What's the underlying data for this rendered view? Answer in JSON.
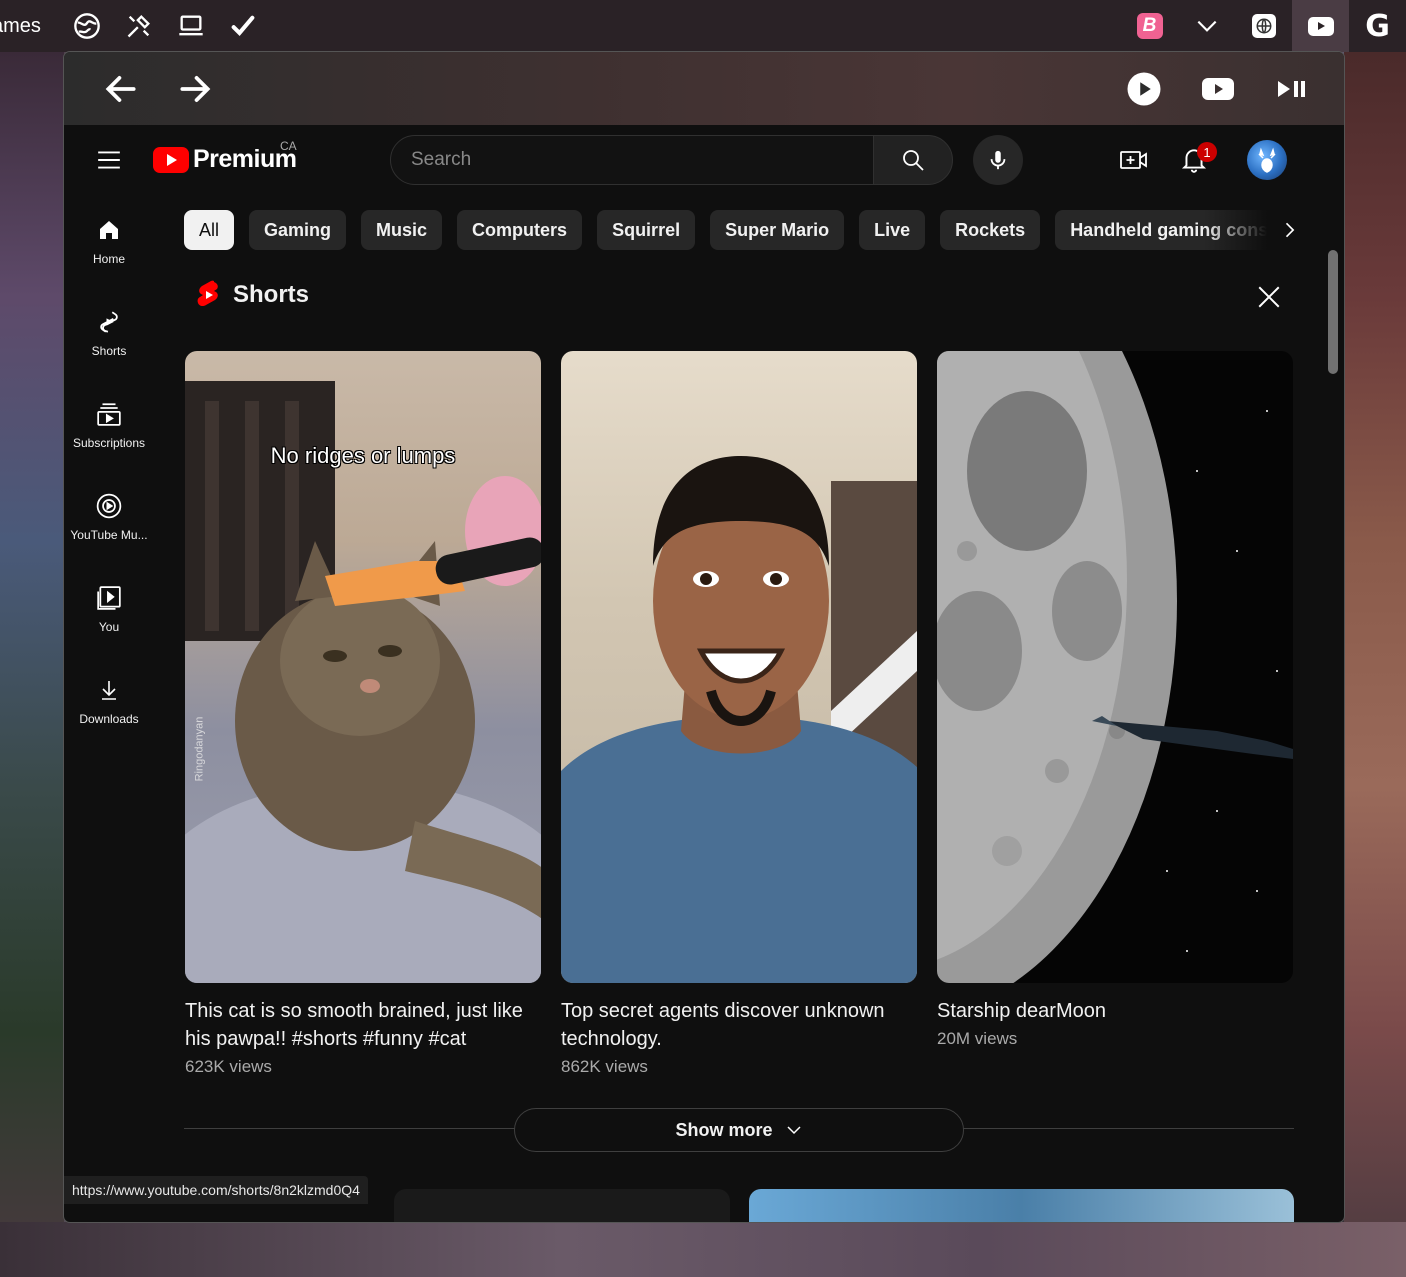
{
  "system_bar": {
    "left_label": "ames",
    "left_icons": [
      "globe-icon",
      "tools-icon",
      "laptop-icon",
      "checkmark-icon"
    ],
    "right_icons": [
      "brave-b-icon",
      "chevron-down-icon",
      "translate-globe-icon",
      "youtube-icon",
      "google-g-icon"
    ]
  },
  "titlebar": {
    "back_icon": "arrow-left-icon",
    "forward_icon": "arrow-right-icon",
    "controls": [
      "play-circle-icon",
      "youtube-play-icon",
      "play-pause-icon"
    ]
  },
  "header": {
    "logo_text": "Premium",
    "country_code": "CA",
    "search_placeholder": "Search",
    "notification_count": "1"
  },
  "sidebar": {
    "items": [
      {
        "label": "Home",
        "icon": "home-icon"
      },
      {
        "label": "Shorts",
        "icon": "shorts-icon"
      },
      {
        "label": "Subscriptions",
        "icon": "subscriptions-icon"
      },
      {
        "label": "YouTube Mu...",
        "icon": "youtube-music-icon"
      },
      {
        "label": "You",
        "icon": "you-library-icon"
      },
      {
        "label": "Downloads",
        "icon": "download-icon"
      }
    ]
  },
  "chips": [
    "All",
    "Gaming",
    "Music",
    "Computers",
    "Squirrel",
    "Super Mario",
    "Live",
    "Rockets",
    "Handheld gaming consoles"
  ],
  "shorts": {
    "title": "Shorts",
    "items": [
      {
        "title": "This cat is so smooth brained, just like his pawpa!! #shorts #funny #cat",
        "views": "623K views",
        "overlay_text": "No ridges or lumps",
        "watermark": "Ringodanyan"
      },
      {
        "title": "Top secret agents discover unknown technology.",
        "views": "862K views"
      },
      {
        "title": "Starship dearMoon",
        "views": "20M views"
      }
    ],
    "show_more": "Show more"
  },
  "status_url": "https://www.youtube.com/shorts/8n2klzmd0Q4",
  "colors": {
    "brand_red": "#ff0000",
    "background": "#0f0f0f",
    "chip_bg": "#272727",
    "badge_red": "#cc0000"
  }
}
